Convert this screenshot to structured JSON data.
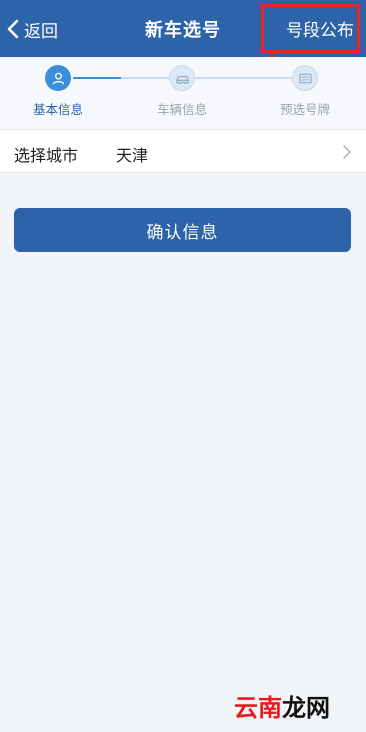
{
  "header": {
    "back_label": "返回",
    "title": "新车选号",
    "release_label": "号段公布"
  },
  "steps": [
    {
      "label": "基本信息",
      "icon": "person-icon",
      "state": "active"
    },
    {
      "label": "车辆信息",
      "icon": "car-icon",
      "state": "inactive"
    },
    {
      "label": "预选号牌",
      "icon": "plate-icon",
      "state": "inactive"
    }
  ],
  "city": {
    "label": "选择城市",
    "value": "天津"
  },
  "confirm_label": "确认信息",
  "watermark": {
    "part1": "云南",
    "part2": "龙网"
  },
  "colors": {
    "header_bg": "#2d63a8",
    "accent": "#3a8fdb",
    "highlight": "#e5262a"
  }
}
